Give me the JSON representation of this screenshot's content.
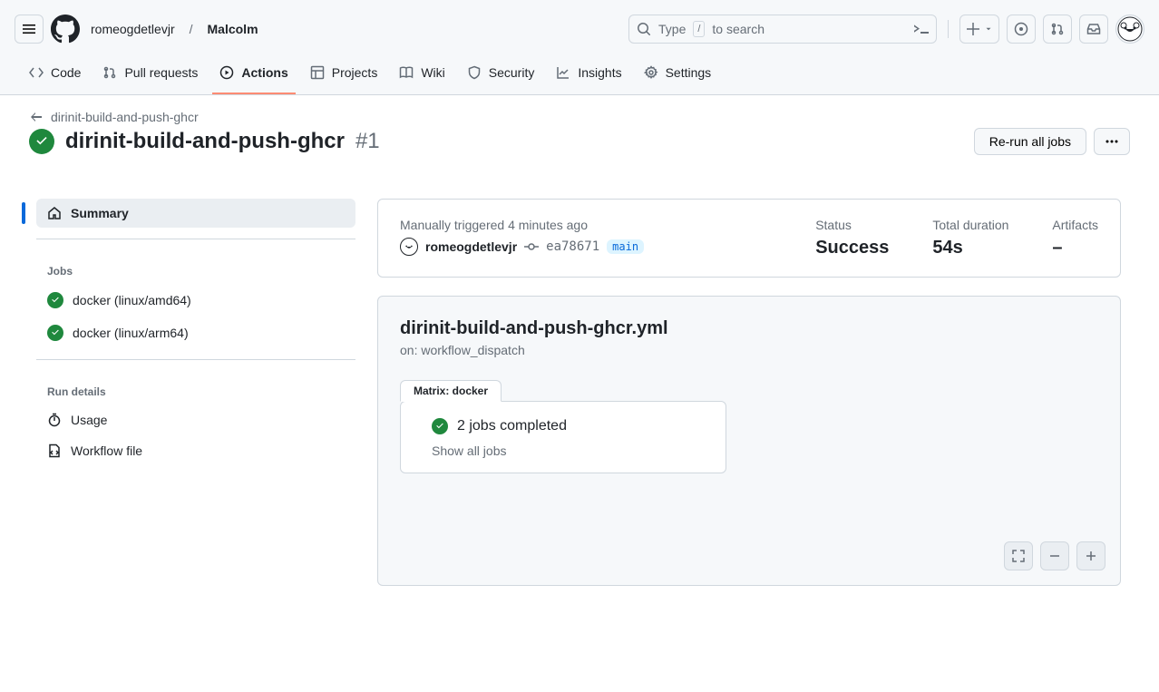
{
  "header": {
    "owner": "romeogdetlevjr",
    "repo": "Malcolm",
    "search_placeholder_prefix": "Type",
    "search_key": "/",
    "search_placeholder_suffix": "to search"
  },
  "nav": {
    "code": "Code",
    "pulls": "Pull requests",
    "actions": "Actions",
    "projects": "Projects",
    "wiki": "Wiki",
    "security": "Security",
    "insights": "Insights",
    "settings": "Settings"
  },
  "run": {
    "workflow_name_back": "dirinit-build-and-push-ghcr",
    "title": "dirinit-build-and-push-ghcr",
    "number": "#1",
    "rerun_label": "Re-run all jobs"
  },
  "sidebar": {
    "summary": "Summary",
    "jobs_heading": "Jobs",
    "jobs": [
      {
        "label": "docker (linux/amd64)"
      },
      {
        "label": "docker (linux/arm64)"
      }
    ],
    "run_details_heading": "Run details",
    "usage": "Usage",
    "workflow_file": "Workflow file"
  },
  "summary": {
    "trigger_prefix": "Manually triggered",
    "trigger_time": "4 minutes ago",
    "actor": "romeogdetlevjr",
    "sha": "ea78671",
    "branch": "main",
    "status_label": "Status",
    "status_value": "Success",
    "duration_label": "Total duration",
    "duration_value": "54s",
    "artifacts_label": "Artifacts",
    "artifacts_value": "–"
  },
  "graph": {
    "file": "dirinit-build-and-push-ghcr.yml",
    "trigger": "on: workflow_dispatch",
    "matrix_label": "Matrix: docker",
    "jobs_completed": "2 jobs completed",
    "show_all": "Show all jobs"
  }
}
